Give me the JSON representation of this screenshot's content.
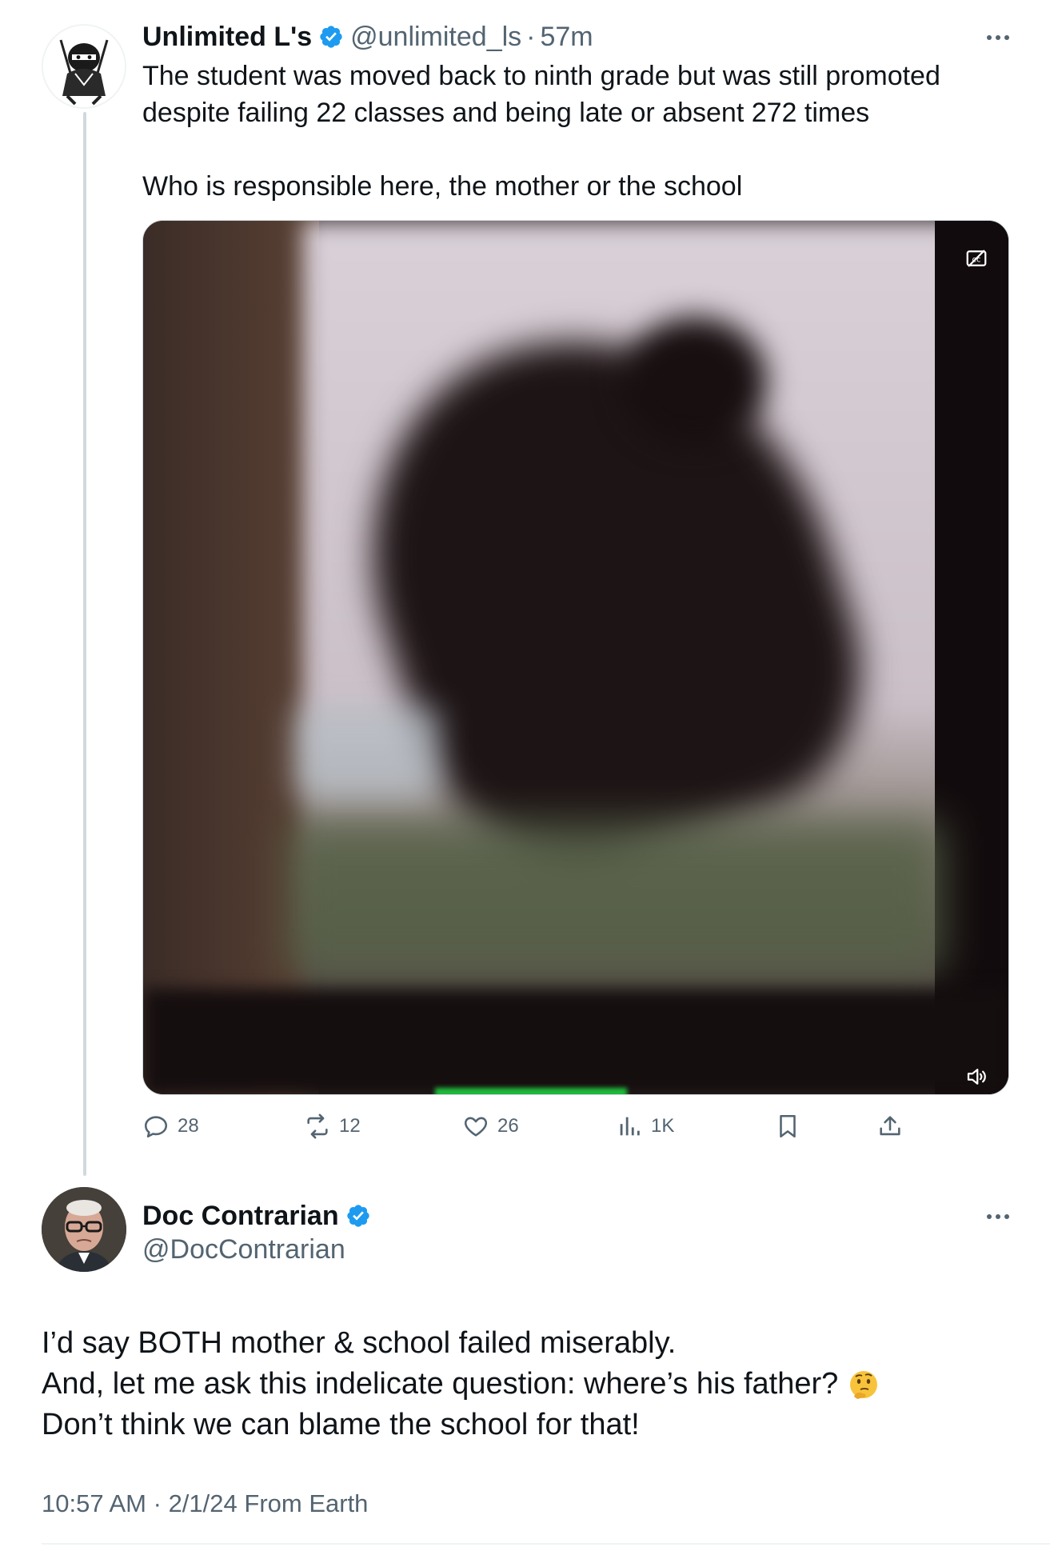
{
  "original_post": {
    "display_name": "Unlimited L's",
    "handle": "@unlimited_ls",
    "separator": "·",
    "time": "57m",
    "text_line_1": "The student was moved back to ninth grade but was still promoted",
    "text_line_2": "despite failing 22 classes and being late or absent 272 times",
    "text_line_3": "Who is responsible here, the mother or the school",
    "media": {
      "type": "video",
      "caption_icon": "closed-captions-icon",
      "volume_icon": "volume-icon"
    },
    "actions": {
      "replies": "28",
      "reposts": "12",
      "likes": "26",
      "views": "1K"
    }
  },
  "reply_post": {
    "display_name": "Doc Contrarian",
    "handle": "@DocContrarian",
    "text_line_1": "I’d say BOTH mother & school failed miserably.",
    "text_line_2": "And, let me ask this indelicate question: where’s his father?",
    "text_line_3": "Don’t think we can blame the school for that!",
    "emoji": "thinking-face-icon",
    "time": "10:57 AM",
    "separator": "·",
    "date": "2/1/24",
    "source": "From Earth"
  },
  "colors": {
    "verified": "#1d9bf0",
    "secondary_text": "#536471",
    "thread_line": "#cfd9de"
  }
}
